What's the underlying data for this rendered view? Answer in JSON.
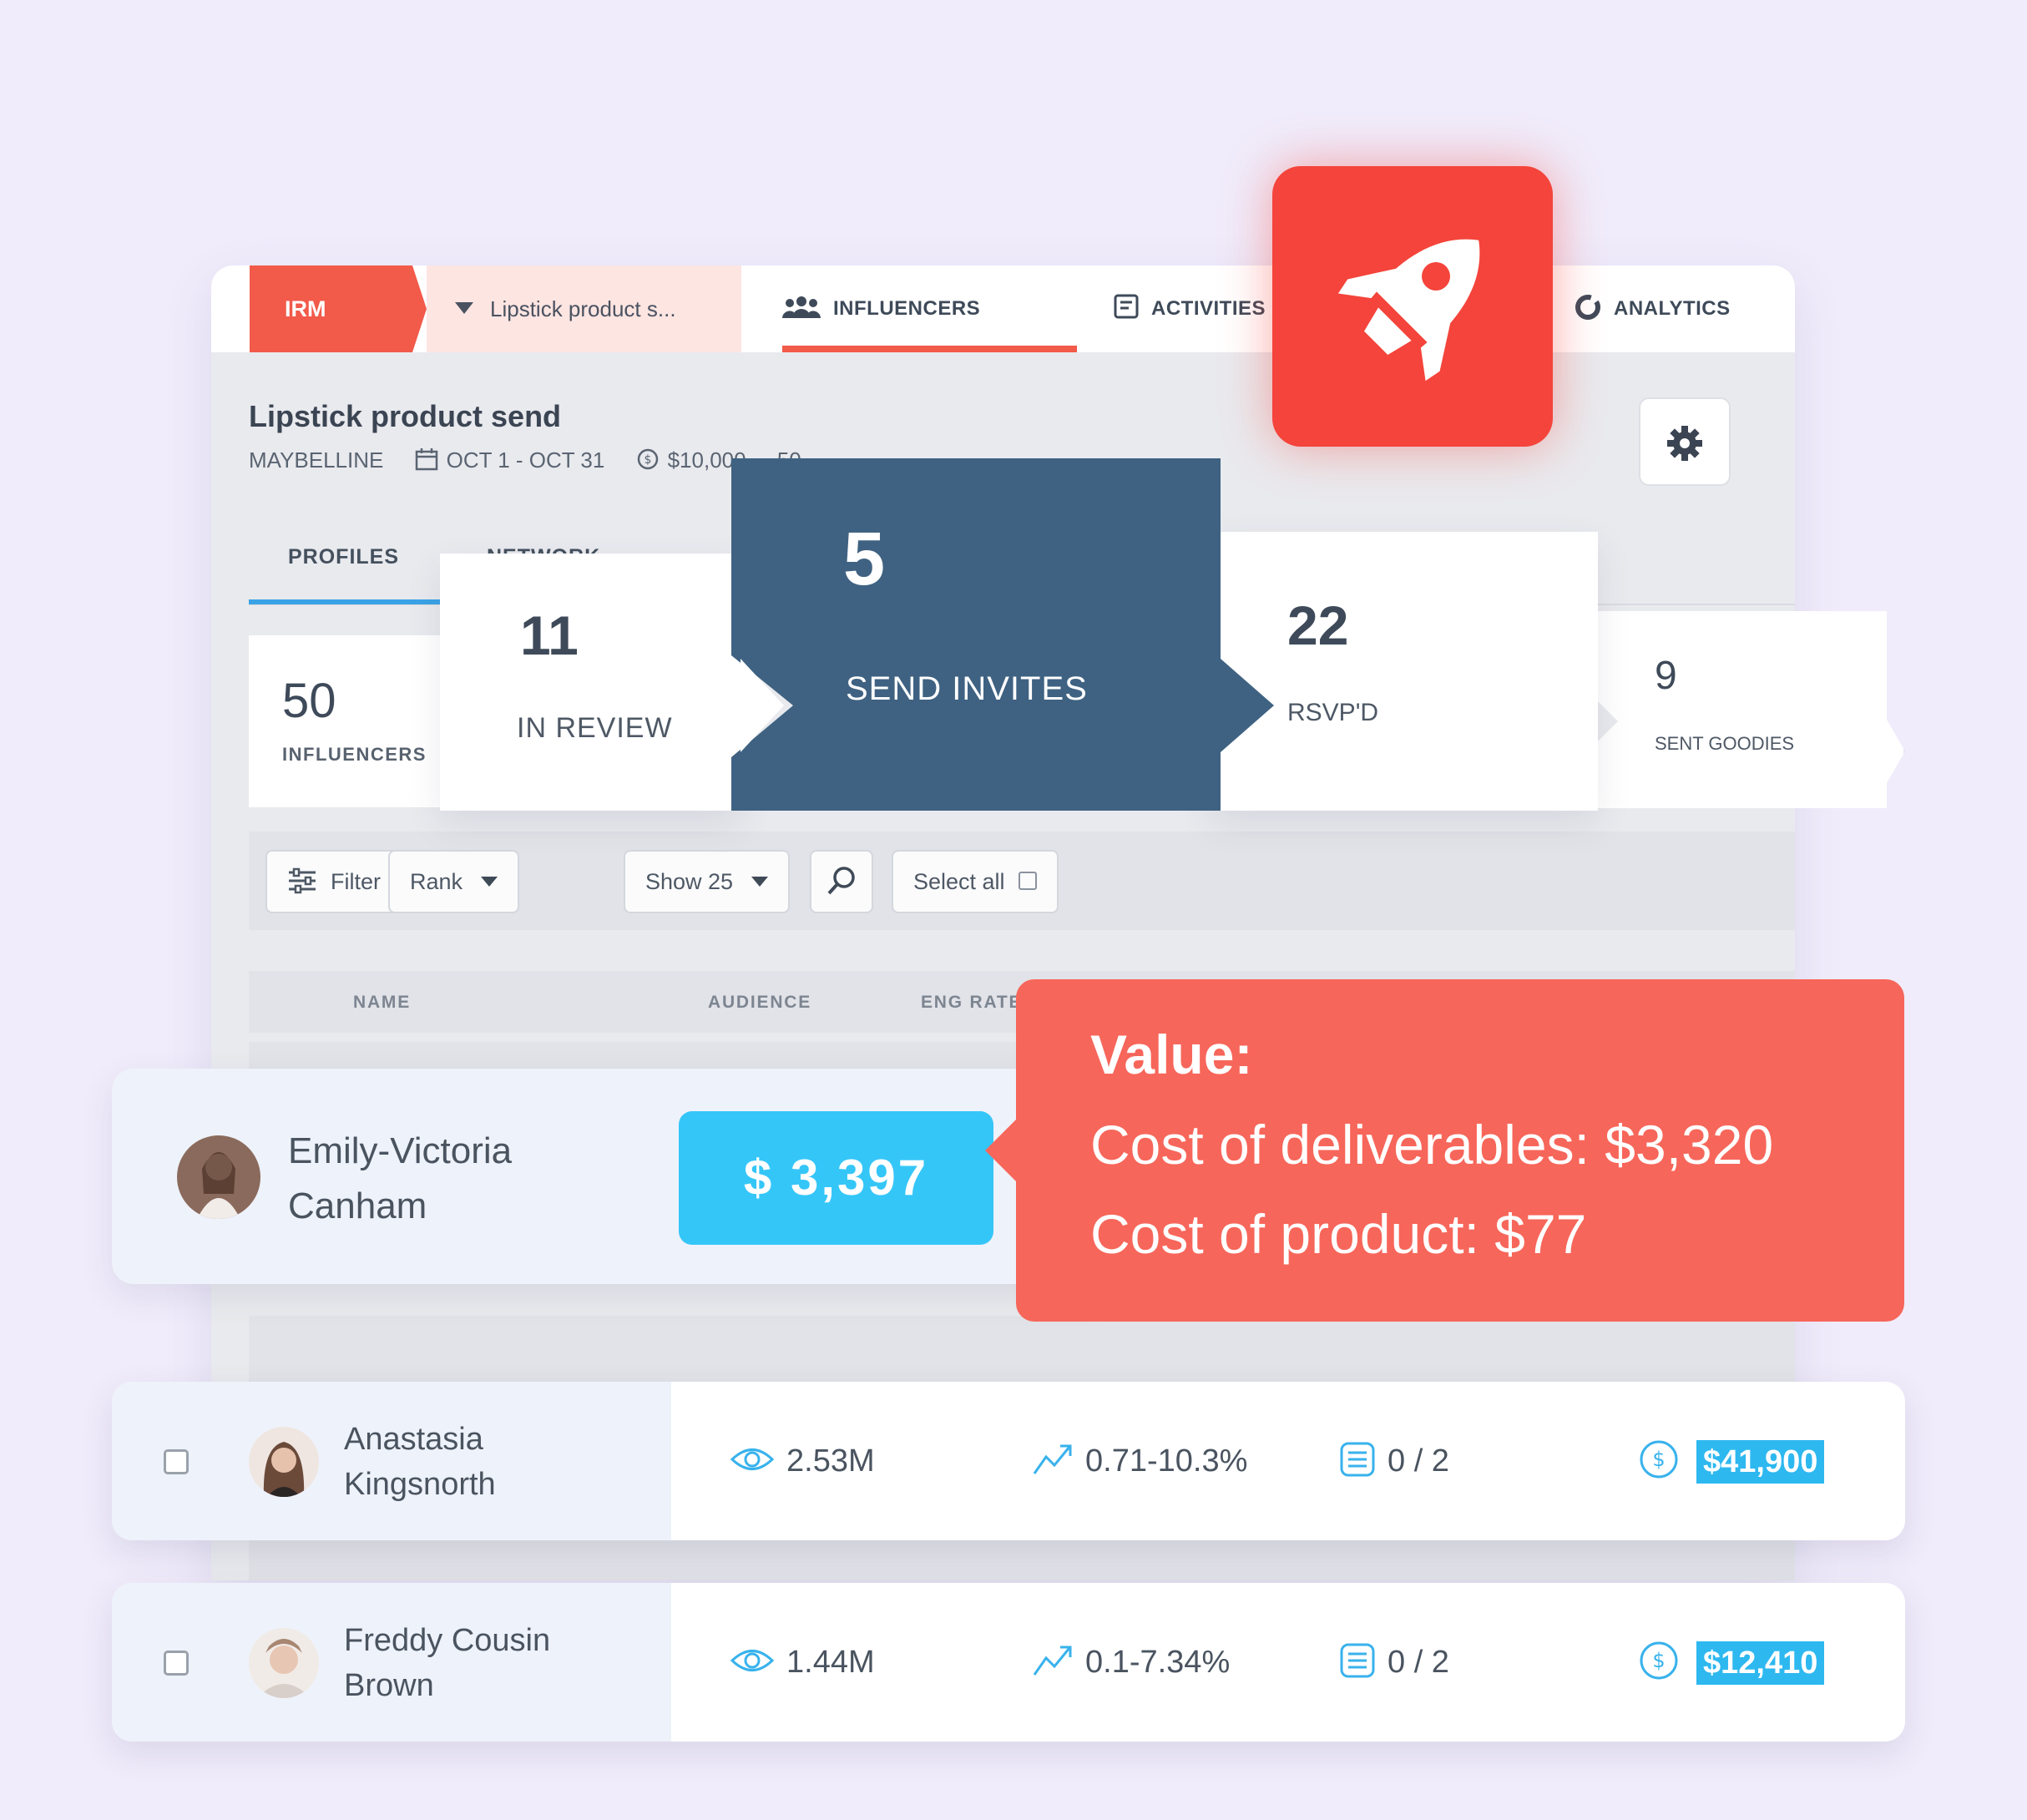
{
  "nav": {
    "brand": "IRM",
    "campaign_selector": "Lipstick product s...",
    "tabs": [
      "INFLUENCERS",
      "ACTIVITIES",
      "ANALYTICS"
    ]
  },
  "campaign": {
    "title": "Lipstick product send",
    "brand": "MAYBELLINE",
    "dates": "OCT 1 - OCT 31",
    "budget": "$10,000",
    "count": "50"
  },
  "subtabs": [
    "PROFILES",
    "NETWORK"
  ],
  "pipeline": [
    {
      "value": "50",
      "label": "INFLUENCERS"
    },
    {
      "value": "11",
      "label": "IN REVIEW"
    },
    {
      "value": "5",
      "label": "SEND INVITES"
    },
    {
      "value": "22",
      "label": "RSVP'D"
    },
    {
      "value": "9",
      "label": "SENT GOODIES"
    }
  ],
  "toolbar": {
    "filter": "Filter",
    "rank": "Rank",
    "show": "Show 25",
    "select_all": "Select all"
  },
  "table_headers": [
    "NAME",
    "AUDIENCE",
    "ENG RATE"
  ],
  "featured": {
    "name": "Emily-Victoria Canham",
    "value": "$ 3,397"
  },
  "tooltip": {
    "title": "Value:",
    "line1": "Cost of deliverables: $3,320",
    "line2": "Cost of product: $77"
  },
  "rows": [
    {
      "name": "Anastasia Kingsnorth",
      "audience": "2.53M",
      "eng_rate": "0.71-10.3%",
      "deliverables": "0 / 2",
      "price": "$41,900"
    },
    {
      "name": "Freddy Cousin Brown",
      "audience": "1.44M",
      "eng_rate": "0.1-7.34%",
      "deliverables": "0 / 2",
      "price": "$12,410"
    }
  ],
  "colors": {
    "brand_red": "#f25a4a",
    "rocket_red": "#f4443b",
    "stage_active": "#3f6282",
    "tooltip_coral": "#f7665a",
    "value_blue": "#35c6f8",
    "price_blue": "#2eb8f0"
  },
  "icons": [
    "rocket-icon",
    "gear-icon",
    "people-icon",
    "activities-icon",
    "analytics-icon",
    "calendar-icon",
    "dollar-icon",
    "filter-icon",
    "search-icon",
    "eye-icon",
    "trend-icon",
    "list-icon"
  ]
}
